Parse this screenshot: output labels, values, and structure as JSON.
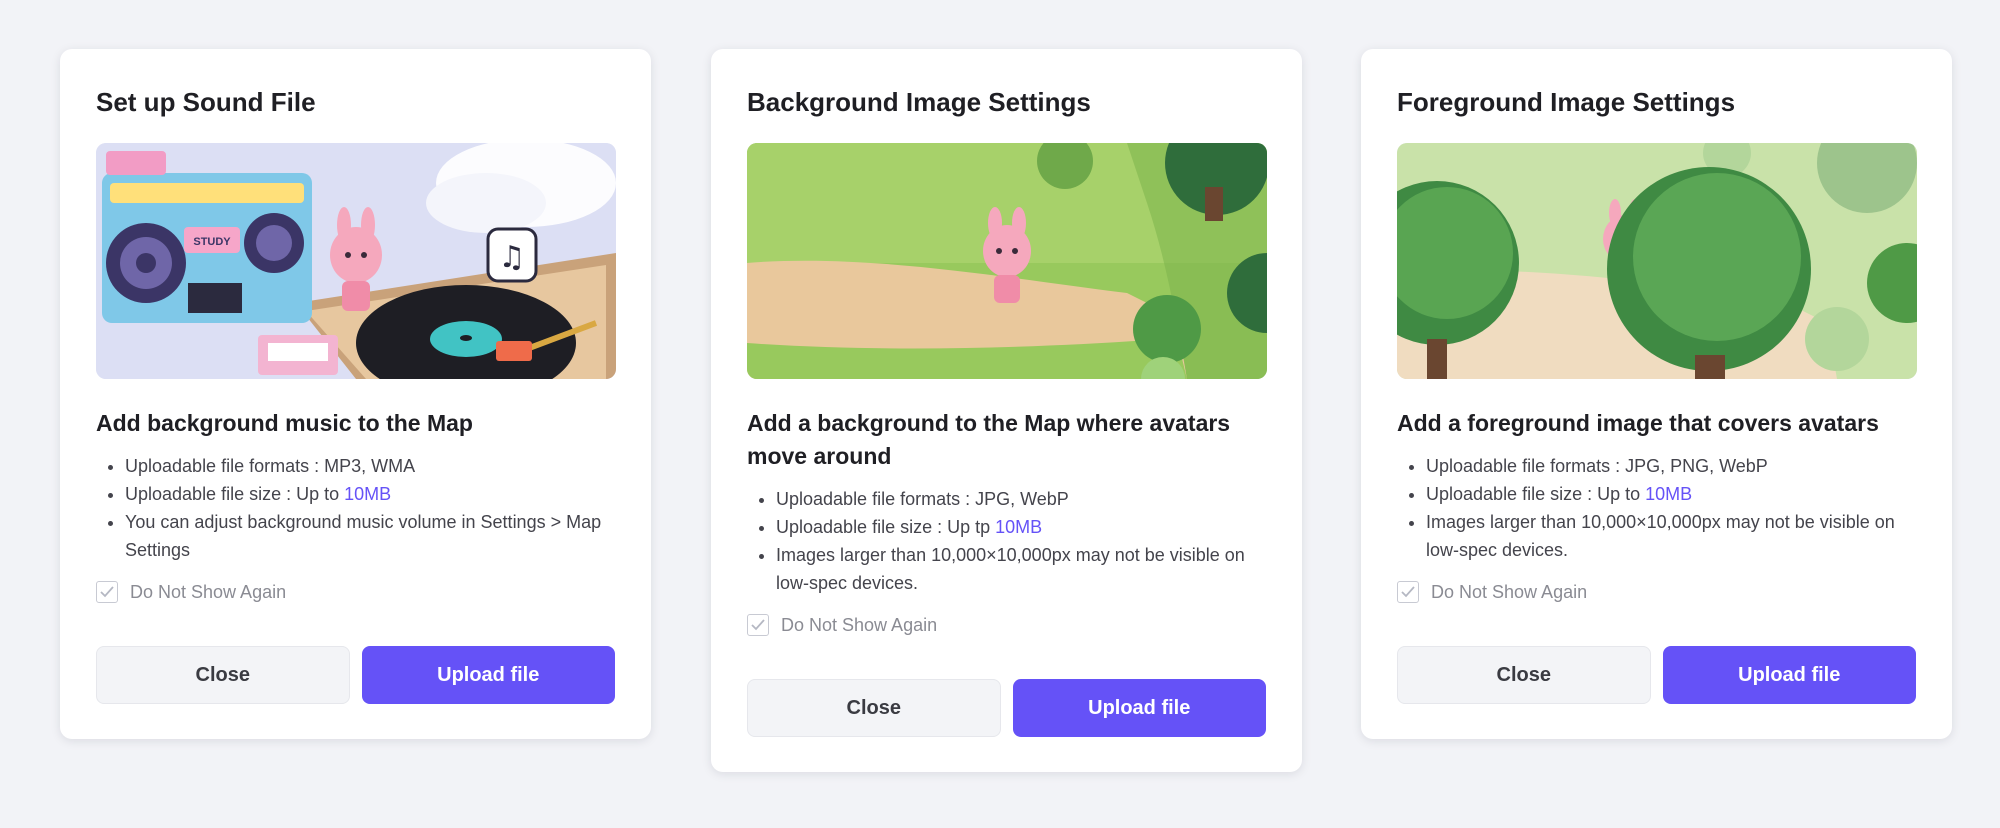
{
  "cards": [
    {
      "title": "Set up Sound File",
      "heading": "Add background music to the Map",
      "bullets": [
        {
          "text": "Uploadable file formats : MP3, WMA"
        },
        {
          "text": "Uploadable file size : Up to ",
          "highlight": "10MB"
        },
        {
          "text": "You can adjust background music volume in Settings > Map Settings"
        }
      ],
      "do_not_show": "Do Not Show Again",
      "close_label": "Close",
      "upload_label": "Upload file",
      "hero_text": "STUDY"
    },
    {
      "title": "Background Image Settings",
      "heading": "Add a background to the Map where avatars move around",
      "bullets": [
        {
          "text": "Uploadable file formats : JPG, WebP"
        },
        {
          "text": "Uploadable file size : Up tp ",
          "highlight": "10MB"
        },
        {
          "text": "Images larger than 10,000×10,000px may not be visible on low-spec devices."
        }
      ],
      "do_not_show": "Do Not Show Again",
      "close_label": "Close",
      "upload_label": "Upload file"
    },
    {
      "title": "Foreground Image Settings",
      "heading": "Add a foreground image that covers avatars",
      "bullets": [
        {
          "text": "Uploadable file formats : JPG, PNG, WebP"
        },
        {
          "text": "Uploadable file size : Up to ",
          "highlight": "10MB"
        },
        {
          "text": "Images larger than 10,000×10,000px may not be visible on low-spec devices."
        }
      ],
      "do_not_show": "Do Not Show Again",
      "close_label": "Close",
      "upload_label": "Upload file"
    }
  ],
  "colors": {
    "accent": "#6552f7",
    "background": "#f2f3f7",
    "card": "#ffffff",
    "close_button": "#f3f4f7"
  },
  "icons": [
    "check-icon",
    "music-note-icon"
  ]
}
